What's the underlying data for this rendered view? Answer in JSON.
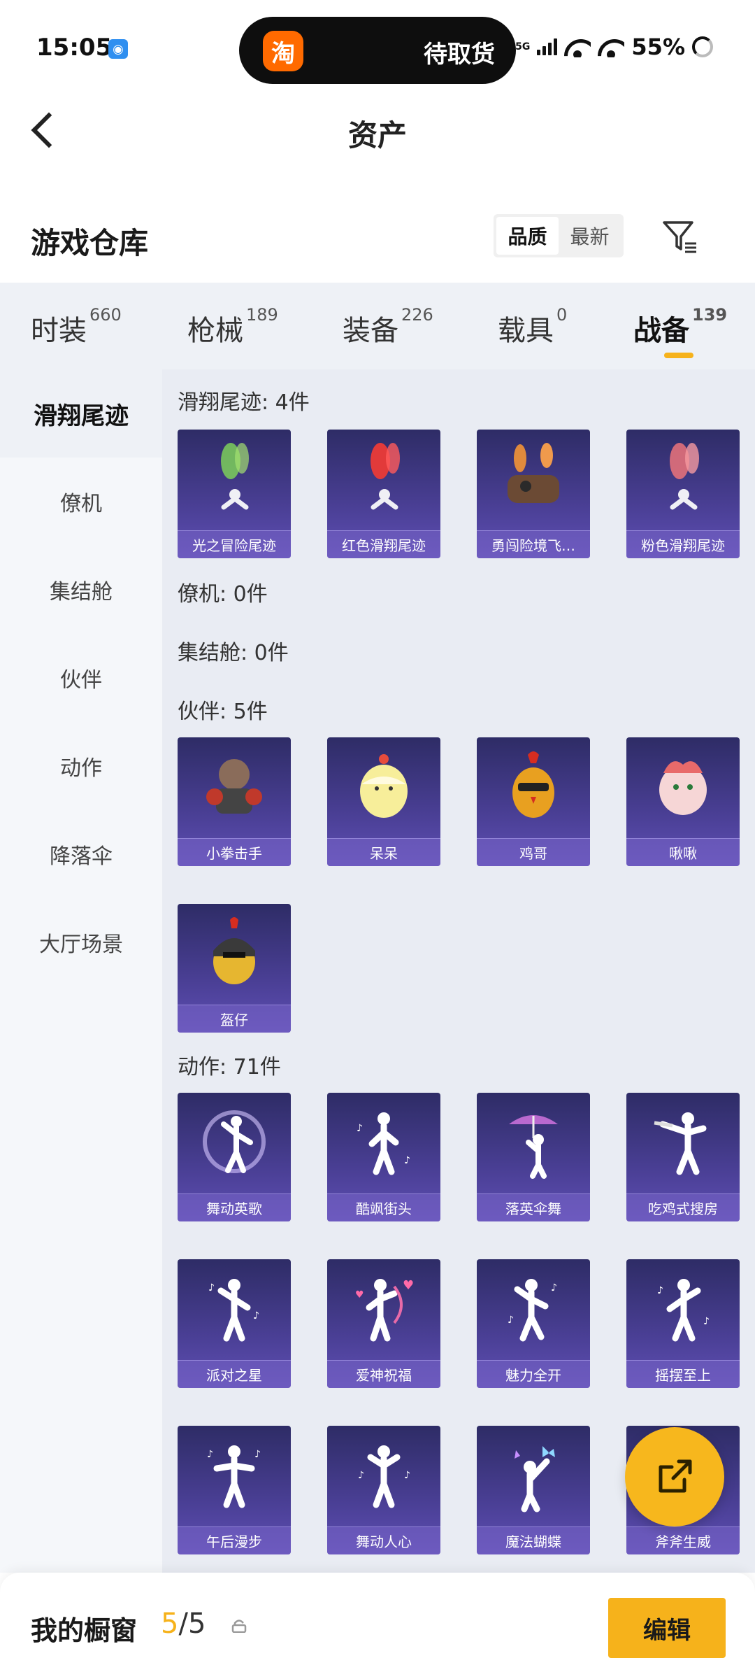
{
  "status_bar": {
    "time": "15:05",
    "island_text": "待取货",
    "taobao_glyph": "淘",
    "network": "5G",
    "battery": "55%"
  },
  "header": {
    "title": "资产"
  },
  "section": {
    "title": "游戏仓库",
    "sort_options": [
      "品质",
      "最新"
    ],
    "active_sort": "品质"
  },
  "tabs": [
    {
      "label": "时装",
      "count": "660"
    },
    {
      "label": "枪械",
      "count": "189"
    },
    {
      "label": "装备",
      "count": "226"
    },
    {
      "label": "载具",
      "count": "0"
    },
    {
      "label": "战备",
      "count": "139",
      "active": true
    }
  ],
  "sidenav": [
    {
      "label": "滑翔尾迹",
      "active": true
    },
    {
      "label": "僚机"
    },
    {
      "label": "集结舱"
    },
    {
      "label": "伙伴"
    },
    {
      "label": "动作"
    },
    {
      "label": "降落伞"
    },
    {
      "label": "大厅场景"
    }
  ],
  "groups": [
    {
      "heading": "滑翔尾迹: 4件",
      "items": [
        "光之冒险尾迹",
        "红色滑翔尾迹",
        "勇闯险境飞…",
        "粉色滑翔尾迹"
      ]
    },
    {
      "heading": "僚机: 0件",
      "items": []
    },
    {
      "heading": "集结舱: 0件",
      "items": []
    },
    {
      "heading": "伙伴: 5件",
      "items": [
        "小拳击手",
        "呆呆",
        "鸡哥",
        "啾啾",
        "盔仔"
      ]
    },
    {
      "heading": "动作: 71件",
      "items": [
        "舞动英歌",
        "酷飒街头",
        "落英伞舞",
        "吃鸡式搜房",
        "派对之星",
        "爱神祝福",
        "魅力全开",
        "摇摆至上",
        "午后漫步",
        "舞动人心",
        "魔法蝴蝶",
        "斧斧生威"
      ]
    }
  ],
  "bottom_bar": {
    "title": "我的橱窗",
    "count_current": "5",
    "count_sep": "/",
    "count_total": "5",
    "edit_label": "编辑"
  },
  "colors": {
    "accent": "#f6b21b",
    "card_bg": "#4a3f95",
    "content_bg": "#e9ecf3"
  }
}
